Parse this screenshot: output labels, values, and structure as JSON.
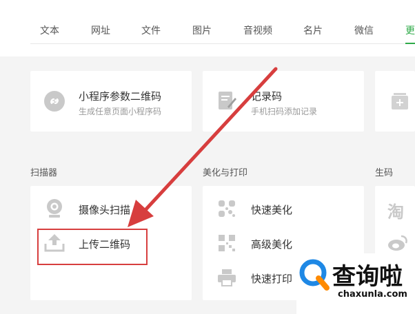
{
  "tabs": [
    {
      "label": "文本"
    },
    {
      "label": "网址"
    },
    {
      "label": "文件"
    },
    {
      "label": "图片"
    },
    {
      "label": "音视频"
    },
    {
      "label": "名片"
    },
    {
      "label": "微信"
    },
    {
      "label": "更"
    }
  ],
  "active_tab": 7,
  "top_cards": [
    {
      "title": "小程序参数二维码",
      "desc": "生成任意页面小程序码",
      "icon": "link-icon"
    },
    {
      "title": "记录码",
      "desc": "手机扫码添加记录",
      "icon": "edit-note-icon"
    },
    {
      "title": "",
      "desc": "",
      "icon": "add-box-icon"
    }
  ],
  "sections": {
    "scanner": {
      "title": "扫描器",
      "items": [
        {
          "label": "摄像头扫描",
          "icon": "camera-icon"
        },
        {
          "label": "上传二维码",
          "icon": "upload-icon"
        }
      ]
    },
    "beautify": {
      "title": "美化与打印",
      "items": [
        {
          "label": "快速美化",
          "icon": "qr-fancy-icon"
        },
        {
          "label": "高级美化",
          "icon": "qr-advanced-icon"
        },
        {
          "label": "快速打印",
          "icon": "printer-icon"
        }
      ]
    },
    "generate": {
      "title": "生码",
      "items": [
        {
          "label": "淘",
          "icon": "taobao-icon"
        },
        {
          "label": "",
          "icon": "weibo-icon"
        }
      ]
    }
  },
  "watermark": {
    "name": "查询啦",
    "domain": "chaxunla.com"
  },
  "colors": {
    "accent": "#2eaa48",
    "annotation": "#d73e3e",
    "brand_blue": "#1e88e5",
    "brand_orange": "#ff8a00"
  }
}
